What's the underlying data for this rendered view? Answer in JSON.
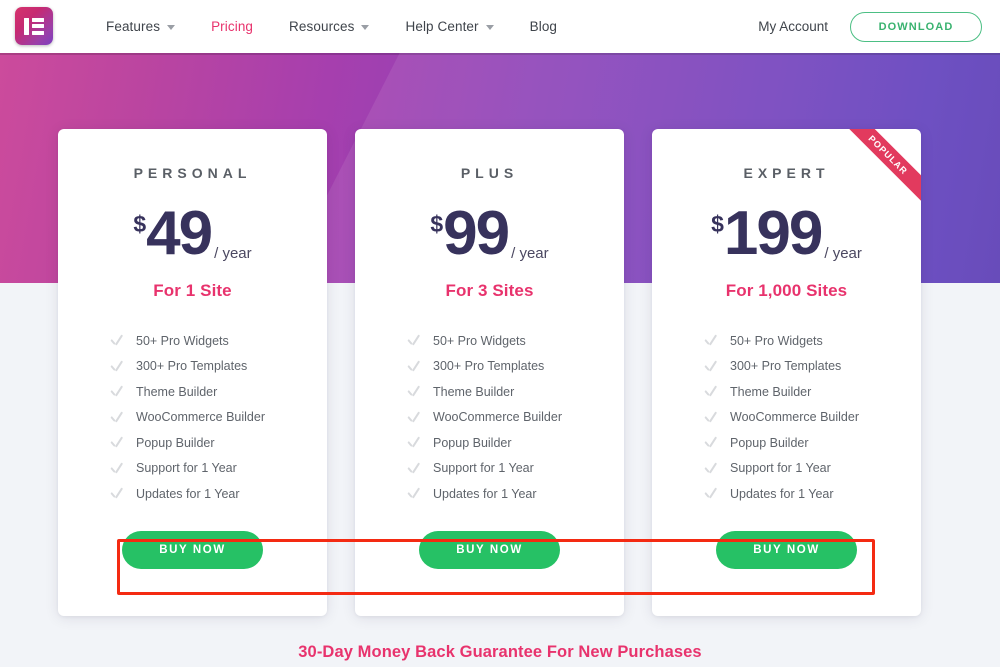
{
  "header": {
    "logo_label": "Elementor logo",
    "nav": [
      {
        "label": "Features",
        "has_caret": true,
        "active": false
      },
      {
        "label": "Pricing",
        "has_caret": false,
        "active": true
      },
      {
        "label": "Resources",
        "has_caret": true,
        "active": false
      },
      {
        "label": "Help Center",
        "has_caret": true,
        "active": false
      },
      {
        "label": "Blog",
        "has_caret": false,
        "active": false
      }
    ],
    "my_account_label": "My Account",
    "download_label": "DOWNLOAD"
  },
  "colors": {
    "accent_pink": "#e8336d",
    "buy_green": "#26c165",
    "download_green": "#39b26f",
    "price_navy": "#37325c",
    "highlight_red": "#f42a12",
    "ribbon_red": "#e23a5e",
    "page_bg": "#f2f4f8"
  },
  "plans": [
    {
      "name": "PERSONAL",
      "currency": "$",
      "amount": "49",
      "period": "/ year",
      "sites": "For 1 Site",
      "popular": false,
      "ribbon_label": "",
      "features": [
        "50+ Pro Widgets",
        "300+ Pro Templates",
        "Theme Builder",
        "WooCommerce Builder",
        "Popup Builder",
        "Support for 1 Year",
        "Updates for 1 Year"
      ],
      "cta_label": "BUY NOW"
    },
    {
      "name": "PLUS",
      "currency": "$",
      "amount": "99",
      "period": "/ year",
      "sites": "For 3 Sites",
      "popular": false,
      "ribbon_label": "",
      "features": [
        "50+ Pro Widgets",
        "300+ Pro Templates",
        "Theme Builder",
        "WooCommerce Builder",
        "Popup Builder",
        "Support for 1 Year",
        "Updates for 1 Year"
      ],
      "cta_label": "BUY NOW"
    },
    {
      "name": "EXPERT",
      "currency": "$",
      "amount": "199",
      "period": "/ year",
      "sites": "For 1,000 Sites",
      "popular": true,
      "ribbon_label": "POPULAR",
      "features": [
        "50+ Pro Widgets",
        "300+ Pro Templates",
        "Theme Builder",
        "WooCommerce Builder",
        "Popup Builder",
        "Support for 1 Year",
        "Updates for 1 Year"
      ],
      "cta_label": "BUY NOW"
    }
  ],
  "guarantee": "30-Day Money Back Guarantee For New Purchases"
}
